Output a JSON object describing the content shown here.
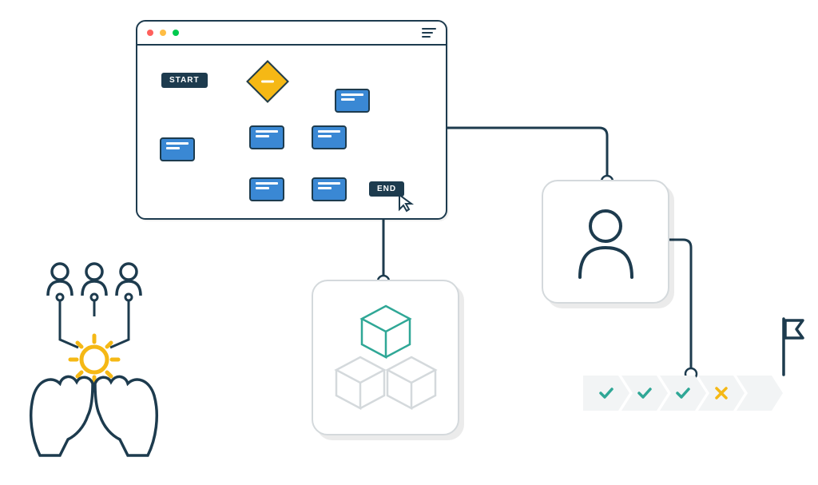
{
  "colors": {
    "dark": "#1d3b4e",
    "blue": "#3a88d4",
    "yellow": "#f5b815",
    "teal": "#2fa796",
    "cardBorder": "#d4d9dc",
    "chevronBg": "#f2f4f5"
  },
  "browser": {
    "traffic_lights": [
      "red",
      "yellow",
      "green"
    ]
  },
  "flowchart": {
    "start_label": "START",
    "end_label": "END"
  },
  "progress": {
    "steps": [
      {
        "status": "check"
      },
      {
        "status": "check"
      },
      {
        "status": "check"
      },
      {
        "status": "cross"
      },
      {
        "status": "empty"
      }
    ]
  },
  "icons": {
    "user": "user-icon",
    "cubes": "cubes-icon",
    "gear": "gear-icon",
    "hands": "hands-icon",
    "flag": "flag-icon",
    "team": "team-users-icon",
    "menu": "hamburger-icon",
    "cursor": "cursor-icon"
  }
}
